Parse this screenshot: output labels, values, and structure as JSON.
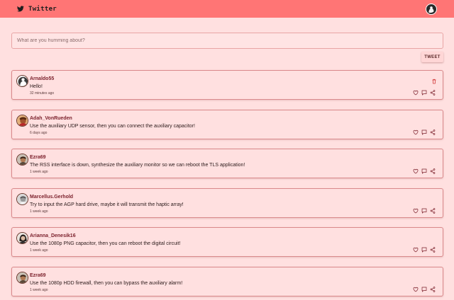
{
  "app": {
    "title": "Twitter"
  },
  "compose": {
    "placeholder": "What are you humming about?",
    "button_label": "TWEET"
  },
  "colors": {
    "header": "#ff7575",
    "background": "#ffe0e0",
    "card_border": "#d9898b",
    "username": "#7a1f2a"
  },
  "tweets": [
    {
      "username": "Arnaldo55",
      "text": "Hello!",
      "time": "32 minutes ago",
      "avatar": "default-silhouette",
      "deletable": true
    },
    {
      "username": "Adah_VonRueden",
      "text": "Use the auxiliary UDP sensor, then you can connect the auxiliary capacitor!",
      "time": "6 days ago",
      "avatar": "photo-red"
    },
    {
      "username": "Ezra69",
      "text": "The RSS interface is down, synthesize the auxiliary monitor so we can reboot the TLS application!",
      "time": "1 week ago",
      "avatar": "photo-brown"
    },
    {
      "username": "Marcellus.Gerhold",
      "text": "Try to input the AGP hard drive, maybe it will transmit the haptic array!",
      "time": "1 week ago",
      "avatar": "photo-grey"
    },
    {
      "username": "Arianna_Denesik16",
      "text": "Use the 1080p PNG capacitor, then you can reboot the digital circuit!",
      "time": "1 week ago",
      "avatar": "photo-dark"
    },
    {
      "username": "Ezra69",
      "text": "Use the 1080p HDD firewall, then you can bypass the auxiliary alarm!",
      "time": "1 week ago",
      "avatar": "photo-brown"
    }
  ]
}
